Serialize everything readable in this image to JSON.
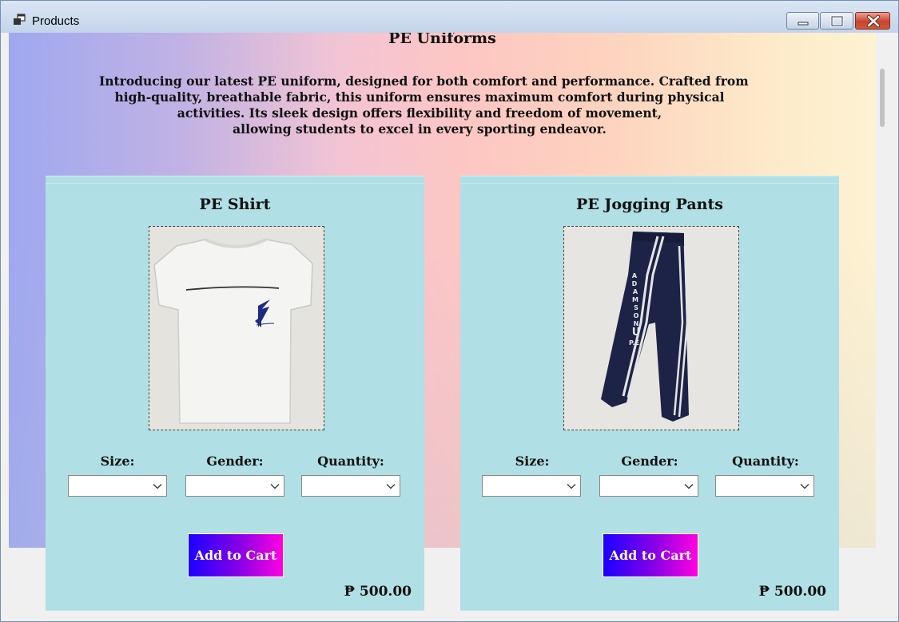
{
  "window": {
    "title": "Products",
    "icon": "app-window-icon",
    "controls": [
      "minimize-icon",
      "maximize-icon",
      "close-icon"
    ]
  },
  "page": {
    "heading": "PE Uniforms",
    "intro_lines": [
      "Introducing our latest PE uniform, designed for both comfort and performance. Crafted from",
      "high-quality, breathable fabric, this uniform ensures maximum comfort during physical",
      "activities. Its sleek design offers flexibility and freedom of movement,",
      "allowing students to excel in every sporting endeavor."
    ]
  },
  "products": [
    {
      "title": "PE Shirt",
      "image": "white-pe-shirt-photo",
      "size_label": "Size:",
      "gender_label": "Gender:",
      "quantity_label": "Quantity:",
      "size_value": "",
      "gender_value": "",
      "quantity_value": "",
      "button_label": "Add to Cart",
      "price": "₱ 500.00"
    },
    {
      "title": "PE Jogging Pants",
      "image": "navy-jogging-pants-photo",
      "size_label": "Size:",
      "gender_label": "Gender:",
      "quantity_label": "Quantity:",
      "size_value": "",
      "gender_value": "",
      "quantity_value": "",
      "button_label": "Add to Cart",
      "price": "₱ 500.00",
      "print_text": [
        "A",
        "D",
        "A",
        "M",
        "S",
        "O",
        "N",
        "U",
        "P.E."
      ]
    }
  ],
  "colors": {
    "card_background": "#b0dfe5",
    "button_gradient_start": "#1a00ff",
    "button_gradient_end": "#ff00e0",
    "pants_navy": "#1c2347"
  }
}
